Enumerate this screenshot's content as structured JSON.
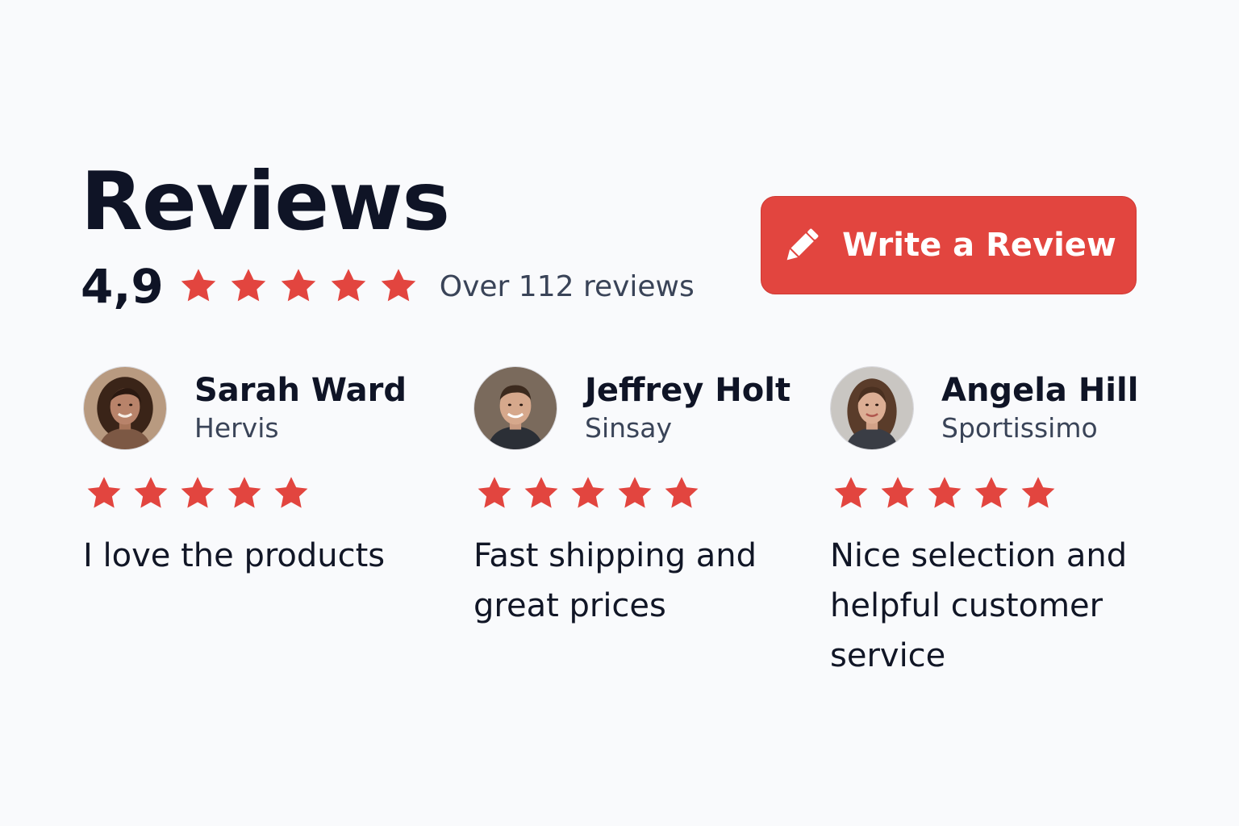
{
  "header": {
    "title": "Reviews",
    "rating": "4,9",
    "rating_value": 4.9,
    "stars_filled": 5,
    "count_text": "Over 112 reviews"
  },
  "write_button": {
    "label": "Write a Review",
    "icon": "pencil-icon"
  },
  "colors": {
    "accent": "#e2453f",
    "text": "#0f1426",
    "muted": "#3a4458",
    "background": "#f9fafc"
  },
  "reviews": [
    {
      "name": "Sarah Ward",
      "store": "Hervis",
      "stars": 5,
      "text": "I love the products"
    },
    {
      "name": "Jeffrey Holt",
      "store": "Sinsay",
      "stars": 5,
      "text": "Fast shipping and great prices"
    },
    {
      "name": "Angela Hill",
      "store": "Sportissimo",
      "stars": 5,
      "text": "Nice selection and helpful customer service"
    }
  ]
}
